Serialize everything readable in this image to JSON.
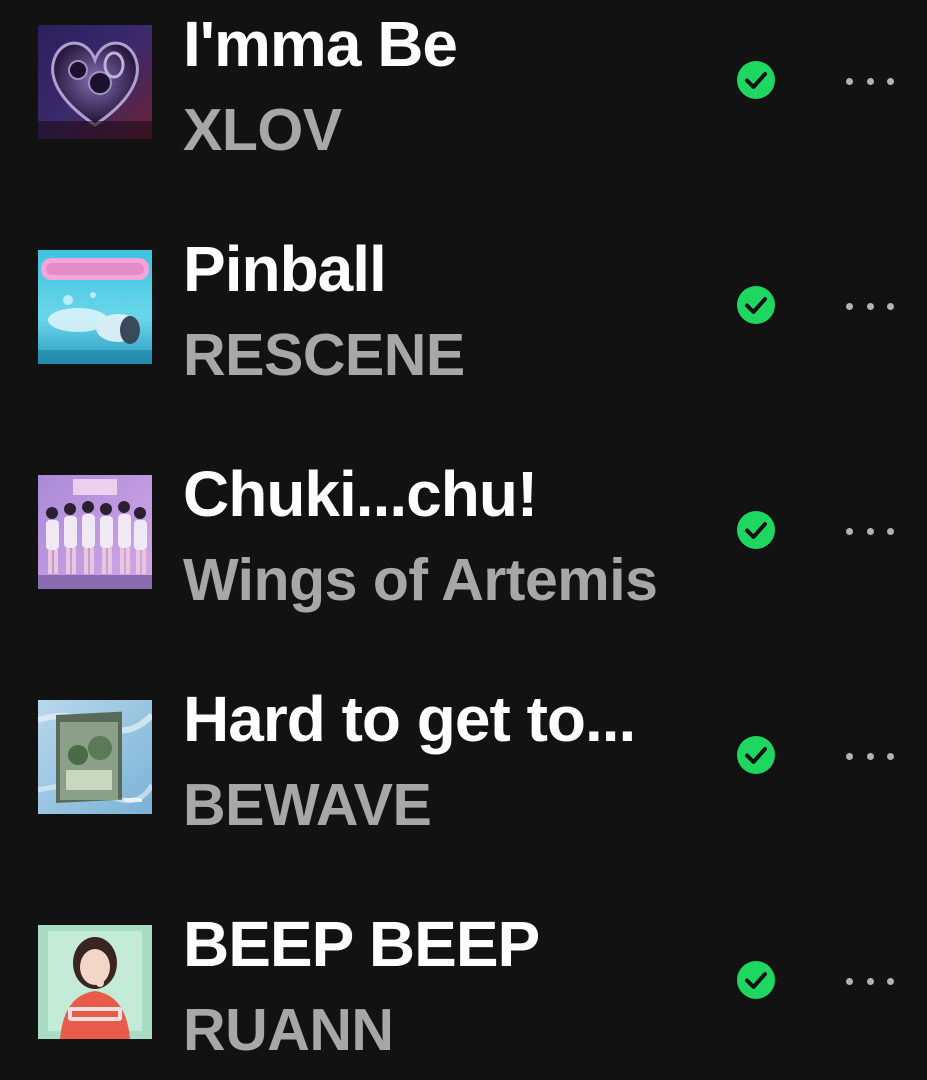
{
  "tracks": [
    {
      "title": "I'mma Be",
      "artist": "XLOV",
      "cover_icon": "xlov-heart-album-art",
      "downloaded": true
    },
    {
      "title": "Pinball",
      "artist": "RESCENE",
      "cover_icon": "scenedrome-album-art",
      "downloaded": true
    },
    {
      "title": "Chuki...chu!",
      "artist": "Wings of Artemis",
      "cover_icon": "group-photo-album-art",
      "downloaded": true
    },
    {
      "title": "Hard to get to...",
      "artist": "BEWAVE",
      "cover_icon": "bewave-album-art",
      "downloaded": true
    },
    {
      "title": "BEEP BEEP",
      "artist": "RUANN",
      "cover_icon": "beep-beep-album-art",
      "downloaded": true
    }
  ],
  "colors": {
    "background": "#121212",
    "title": "#ffffff",
    "artist": "#a7a7a7",
    "downloaded_check": "#1ed760"
  }
}
